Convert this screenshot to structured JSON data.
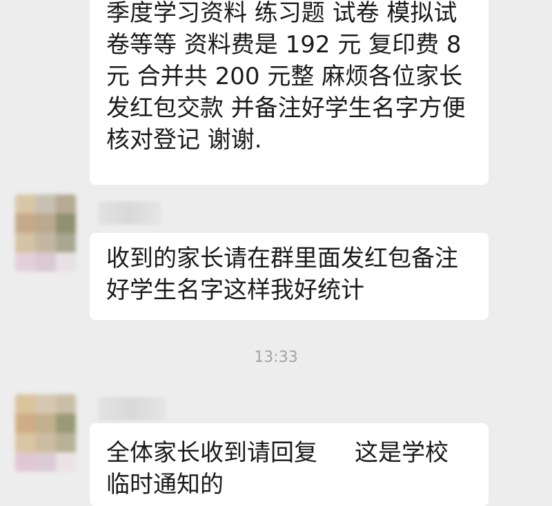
{
  "colors": {
    "background": "#ededed",
    "bubble": "#ffffff",
    "text": "#1a1a1a",
    "timestamp": "#a3a3a3"
  },
  "messages": [
    {
      "lines": [
        "季度学习资料 练习题 试卷 模拟试",
        "卷等等 资料费是 192 元 复印费 8",
        "元 合并共 200 元整 麻烦各位家长",
        "发红包交款 并备注好学生名字方便",
        "核对登记 谢谢."
      ]
    },
    {
      "lines": [
        "收到的家长请在群里面发红包备注",
        "好学生名字这样我好统计"
      ]
    },
    {
      "lines": [
        "全体家长收到请回复     这是学校",
        "临时通知的"
      ]
    }
  ],
  "timestamp": "13:33"
}
